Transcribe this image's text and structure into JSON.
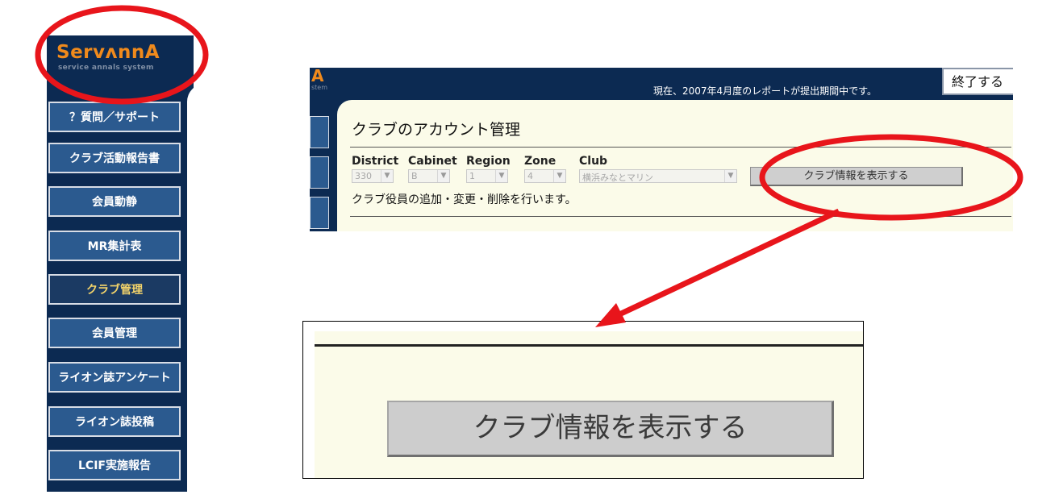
{
  "sidebar": {
    "logo_main": "ServʌnnA",
    "logo_sub": "service annals system",
    "items": [
      {
        "label": "？質問／サポート"
      },
      {
        "label": "クラブ活動報告書"
      },
      {
        "label": "会員動静"
      },
      {
        "label": "MR集計表"
      },
      {
        "label": "クラブ管理",
        "active": true
      },
      {
        "label": "会員管理"
      },
      {
        "label": "ライオン誌アンケート"
      },
      {
        "label": "ライオン誌投稿"
      },
      {
        "label": "LCIF実施報告"
      }
    ]
  },
  "header": {
    "logo_letter": "A",
    "logo_sub": "stem",
    "notice": "現在、2007年4月度のレポートが提出期間中です。",
    "exit_label": "終了する"
  },
  "panel": {
    "title": "クラブのアカウント管理",
    "filters": {
      "labels": [
        "District",
        "Cabinet",
        "Region",
        "Zone",
        "Club"
      ],
      "values": [
        "330",
        "B",
        "1",
        "4",
        "横浜みなとマリン"
      ]
    },
    "show_button": "クラブ情報を表示する",
    "description": "クラブ役員の追加・変更・削除を行います。"
  },
  "zoom": {
    "button_label": "クラブ情報を表示する"
  },
  "colors": {
    "navy": "#0c2a52",
    "nav_button": "#2b5a8f",
    "accent_orange": "#f08a1c",
    "annotation_red": "#e8151b",
    "panel_bg": "#fbfbe9"
  }
}
